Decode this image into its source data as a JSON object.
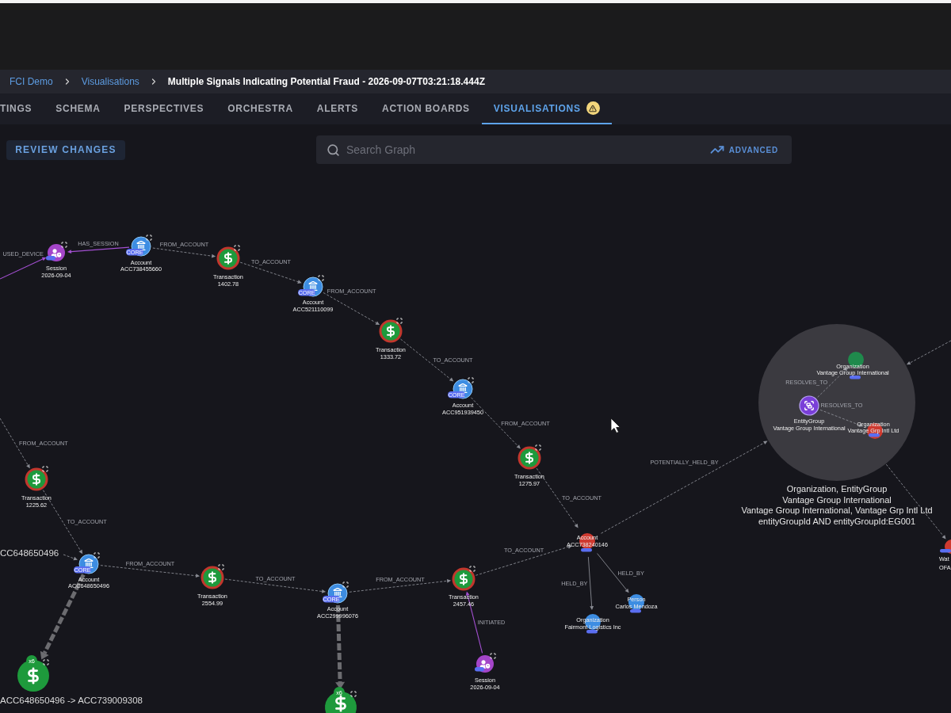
{
  "breadcrumb": [
    {
      "label": "FCI Demo",
      "kind": "link"
    },
    {
      "label": "Visualisations",
      "kind": "link"
    },
    {
      "label": "Multiple Signals Indicating Potential Fraud - 2026-09-07T03:21:18.444Z",
      "kind": "current"
    }
  ],
  "tabs": [
    {
      "label": "TINGS",
      "selected": false,
      "warning": false
    },
    {
      "label": "SCHEMA",
      "selected": false,
      "warning": false
    },
    {
      "label": "PERSPECTIVES",
      "selected": false,
      "warning": false
    },
    {
      "label": "ORCHESTRA",
      "selected": false,
      "warning": false
    },
    {
      "label": "ALERTS",
      "selected": false,
      "warning": false
    },
    {
      "label": "ACTION BOARDS",
      "selected": false,
      "warning": false
    },
    {
      "label": "VISUALISATIONS",
      "selected": true,
      "warning": true
    }
  ],
  "toolbar": {
    "review_button": "REVIEW CHANGES",
    "search_placeholder": "Search Graph",
    "advanced_button": "ADVANCED"
  },
  "graph": {
    "nodes": [
      {
        "kind": "session",
        "title": "Session",
        "subtitle": "2026-09-04",
        "color": "#a445c9",
        "has_tag": true
      },
      {
        "kind": "account",
        "title": "Account",
        "subtitle": "ACC738455660",
        "color": "#3d8de2",
        "tag": "CORE"
      },
      {
        "kind": "transaction",
        "title": "Transaction",
        "subtitle": "1402.78",
        "color": "#1e9a3c"
      },
      {
        "kind": "account",
        "title": "Account",
        "subtitle": "ACC521110099",
        "color": "#3d8de2",
        "tag": "CORE"
      },
      {
        "kind": "transaction",
        "title": "Transaction",
        "subtitle": "1333.72",
        "color": "#1e9a3c"
      },
      {
        "kind": "account",
        "title": "Account",
        "subtitle": "ACC951939450",
        "color": "#3d8de2",
        "tag": "CORE"
      },
      {
        "kind": "transaction",
        "title": "Transaction",
        "subtitle": "1275.97",
        "color": "#1e9a3c"
      },
      {
        "kind": "entity",
        "title": "Account",
        "subtitle": "ACC738240146",
        "color": "#cf3a30",
        "has_tag": true
      },
      {
        "kind": "entity",
        "title": "Person",
        "subtitle": "Carlos Mendoza",
        "color": "#3d8de2",
        "has_tag": true
      },
      {
        "kind": "entity",
        "title": "Organization",
        "subtitle": "Fairmont Logistics Inc",
        "color": "#3d8de2",
        "has_tag": true
      },
      {
        "kind": "transaction",
        "title": "Transaction",
        "subtitle": "2457.46",
        "color": "#1e9a3c"
      },
      {
        "kind": "session",
        "title": "Session",
        "subtitle": "2026-09-04",
        "color": "#a445c9",
        "has_tag": true
      },
      {
        "kind": "account",
        "title": "Account",
        "subtitle": "ACC299996076",
        "color": "#3d8de2",
        "tag": "CORE"
      },
      {
        "kind": "transaction",
        "title": "Transaction",
        "subtitle": "2554.99",
        "color": "#1e9a3c"
      },
      {
        "kind": "account",
        "title": "Account",
        "subtitle": "ACC648650496",
        "color": "#3d8de2",
        "tag": "CORE"
      },
      {
        "kind": "transaction",
        "title": "Transaction",
        "subtitle": "1225.62",
        "color": "#1e9a3c"
      },
      {
        "kind": "aggregate",
        "count": "x6",
        "title": "ACC648650496 -> ACC739009308",
        "color": "#1e9a3c"
      },
      {
        "kind": "aggregate",
        "count": "x6",
        "color": "#1e9a3c"
      },
      {
        "kind": "entity",
        "title": "Organization",
        "subtitle": "Vantage Group International",
        "color": "#1f8a4c",
        "has_tag": true
      },
      {
        "kind": "group",
        "title": "EntityGroup",
        "subtitle": "Vantage Group International",
        "color": "#7a3fd8"
      },
      {
        "kind": "entity",
        "title": "Organization",
        "subtitle": "Vantage Grp Intl Ltd",
        "color": "#cf3a30",
        "has_tag": true
      },
      {
        "kind": "entity",
        "title": "Wat",
        "subtitle": "OFA",
        "color": "#cf3a30",
        "has_tag": true
      },
      {
        "kind": "label_only",
        "title": "CC648650496"
      }
    ],
    "edges": [
      {
        "kind": "session",
        "label": "USED_DEVICE"
      },
      {
        "kind": "session",
        "label": "HAS_SESSION"
      },
      {
        "kind": "dashed",
        "label": "FROM_ACCOUNT"
      },
      {
        "kind": "dashed",
        "label": "TO_ACCOUNT"
      },
      {
        "kind": "dashed",
        "label": "FROM_ACCOUNT"
      },
      {
        "kind": "dashed",
        "label": "TO_ACCOUNT"
      },
      {
        "kind": "dashed",
        "label": "FROM_ACCOUNT"
      },
      {
        "kind": "dashed",
        "label": "TO_ACCOUNT"
      },
      {
        "kind": "dashed",
        "label": "POTENTIALLY_HELD_BY"
      },
      {
        "kind": "solid",
        "label": "HELD_BY"
      },
      {
        "kind": "solid",
        "label": "HELD_BY"
      },
      {
        "kind": "dashed",
        "label": "TO_ACCOUNT"
      },
      {
        "kind": "dashed",
        "label": "FROM_ACCOUNT"
      },
      {
        "kind": "session",
        "label": "INITIATED"
      },
      {
        "kind": "dashed",
        "label": "TO_ACCOUNT"
      },
      {
        "kind": "dashed",
        "label": "FROM_ACCOUNT"
      },
      {
        "kind": "dashed",
        "label": "TO_ACCOUNT"
      },
      {
        "kind": "dashed",
        "label": "FROM_ACCOUNT"
      },
      {
        "kind": "dashed"
      },
      {
        "kind": "aggregate"
      },
      {
        "kind": "aggregate"
      },
      {
        "kind": "dashed"
      },
      {
        "kind": "dashed"
      },
      {
        "kind": "dashed",
        "label": "RESOLVES_TO"
      },
      {
        "kind": "dashed",
        "label": "RESOLVES_TO"
      }
    ],
    "cluster": {
      "caption_lines": [
        "Organization, EntityGroup",
        "Vantage Group International",
        "Vantage Group International, Vantage Grp Intl Ltd",
        "entityGroupId AND entityGroupId:EG001"
      ]
    }
  }
}
